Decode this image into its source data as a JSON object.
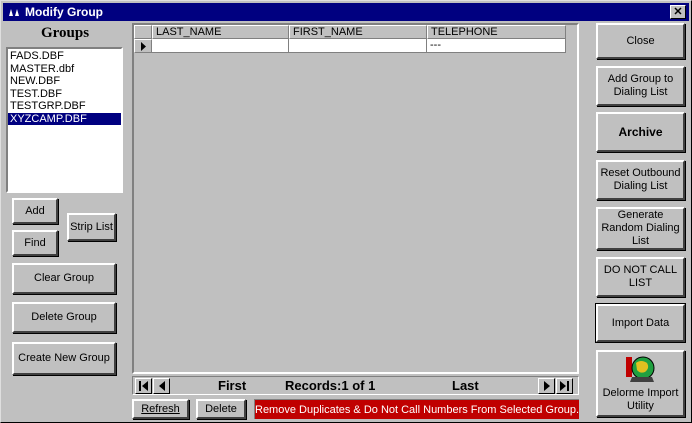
{
  "window": {
    "title": "Modify Group",
    "close_glyph": "✕"
  },
  "groups": {
    "title": "Groups",
    "items": [
      "FADS.DBF",
      "MASTER.dbf",
      "NEW.DBF",
      "TEST.DBF",
      "TESTGRP.DBF",
      "XYZCAMP.DBF"
    ],
    "selected_index": 5
  },
  "left_buttons": {
    "add": "Add",
    "find": "Find",
    "strip_list": "Strip List",
    "clear_group": "Clear Group",
    "delete_group": "Delete Group",
    "create_new_group": "Create New Group"
  },
  "grid": {
    "columns": [
      "LAST_NAME",
      "FIRST_NAME",
      "TELEPHONE"
    ],
    "row": [
      "",
      "",
      "---"
    ]
  },
  "navigator": {
    "first": "First",
    "records": "Records:1 of 1",
    "last": "Last"
  },
  "bottom_buttons": {
    "refresh": "Refresh",
    "delete": "Delete"
  },
  "status_banner": "Remove Duplicates & Do Not Call Numbers From Selected Group.",
  "right_buttons": {
    "close": "Close",
    "add_to_dialing": "Add Group to Dialing List",
    "archive": "Archive",
    "reset_outbound": "Reset Outbound Dialing List",
    "generate_random": "Generate Random Dialing List",
    "do_not_call": "DO NOT CALL LIST",
    "import_data": "Import Data",
    "delorme_import": "Delorme Import Utility"
  },
  "colors": {
    "title_bar": "#000080",
    "selection": "#000080",
    "banner": "#c00000",
    "face": "#c0c0c0"
  }
}
